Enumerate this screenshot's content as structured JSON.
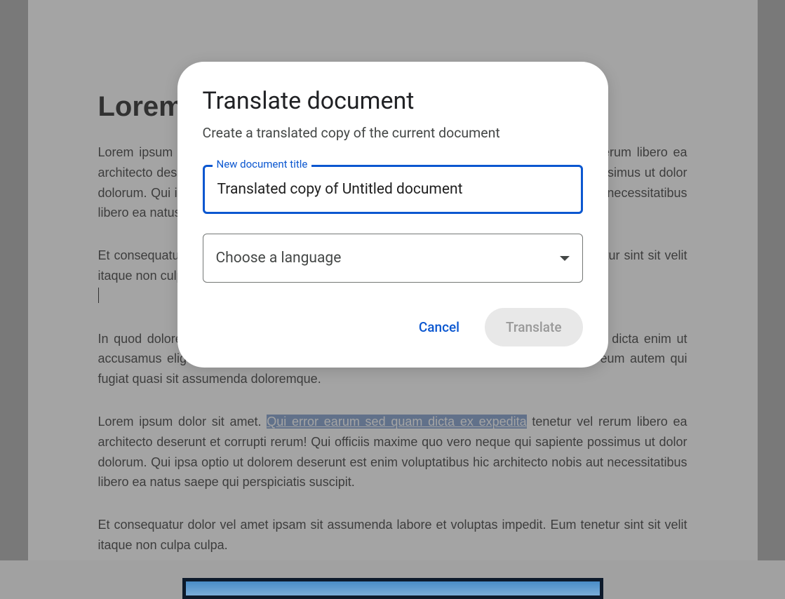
{
  "document": {
    "title": "Lorem Ipsum",
    "paragraph1": "Lorem ipsum dolor sit amet. Qui error earum sed quam dicta ex expedita tenetur vel rerum libero ea architecto deserunt et corrupti rerum! Qui officiis maxime quo vero neque qui sapiente possimus ut dolor dolorum. Qui ipsa optio ut dolorem deserunt est enim voluptatibus hic architecto nobis aut necessitatibus libero ea natus saepe qui perspiciatis suscipit.",
    "paragraph2_part1": "Et consequatur dolor vel amet ipsam sit assumenda labore et voluptas impedit. Eum tenetur sint sit velit itaque non culpa culpa.",
    "paragraph3": "In quod dolore ut autem tenetur sit reprehenderit illum sed galisum exercitationem. Non dicta enim ut accusamus eligendi. A quae officiis aut dolores omnis non esse quidem. Ut odio alias eum autem qui fugiat quasi sit assumenda doloremque.",
    "paragraph4_before": "Lorem ipsum dolor sit amet. ",
    "paragraph4_highlight": "Qui error earum sed quam dicta ex expedita",
    "paragraph4_after": " tenetur vel rerum libero ea architecto deserunt et corrupti rerum! Qui officiis maxime quo vero neque qui sapiente possimus ut dolor dolorum. Qui ipsa optio ut dolorem deserunt est enim voluptatibus hic architecto nobis aut necessitatibus libero ea natus saepe qui perspiciatis suscipit.",
    "paragraph5": "Et consequatur dolor vel amet ipsam sit assumenda labore et voluptas impedit. Eum tenetur sint sit velit itaque non culpa culpa."
  },
  "dialog": {
    "title": "Translate document",
    "subtitle": "Create a translated copy of the current document",
    "input_label": "New document title",
    "input_value": "Translated copy of Untitled document",
    "select_placeholder": "Choose a language",
    "cancel_label": "Cancel",
    "translate_label": "Translate"
  }
}
